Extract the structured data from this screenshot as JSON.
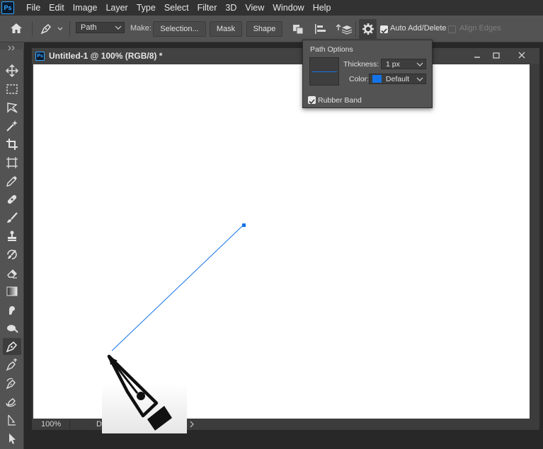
{
  "app": {
    "logo_text": "Ps"
  },
  "menu": [
    "File",
    "Edit",
    "Image",
    "Layer",
    "Type",
    "Select",
    "Filter",
    "3D",
    "View",
    "Window",
    "Help"
  ],
  "options_bar": {
    "mode_value": "Path",
    "make_label": "Make:",
    "selection_button": "Selection...",
    "mask_button": "Mask",
    "shape_button": "Shape",
    "auto_add_delete": {
      "label": "Auto Add/Delete",
      "checked": true
    },
    "align_edges": {
      "label": "Align Edges",
      "checked": false
    }
  },
  "document": {
    "tab_title": "Untitled-1 @ 100% (RGB/8) *",
    "zoom": "100%",
    "status_partial": "D"
  },
  "path_options": {
    "title": "Path Options",
    "thickness_label": "Thickness:",
    "thickness_value": "1 px",
    "color_label": "Color:",
    "color_value": "Default",
    "color_swatch": "#1473e6",
    "rubber_band": {
      "label": "Rubber Band",
      "checked": true
    }
  },
  "colors": {
    "path_line": "#1473e6",
    "anchor": "#1473e6",
    "brand": "#31a8ff"
  },
  "toolbar_tools": [
    "move-icon",
    "marquee-icon",
    "lasso-icon",
    "magic-wand-icon",
    "crop-icon",
    "frame-icon",
    "eyedropper-icon",
    "healing-brush-icon",
    "brush-icon",
    "stamp-icon",
    "history-brush-icon",
    "eraser-icon",
    "gradient-icon",
    "smudge-icon",
    "dodge-icon",
    "pen-icon",
    "freeform-pen-icon",
    "add-anchor-icon",
    "curvature-pen-icon",
    "path-selection-icon",
    "direct-selection-icon"
  ]
}
